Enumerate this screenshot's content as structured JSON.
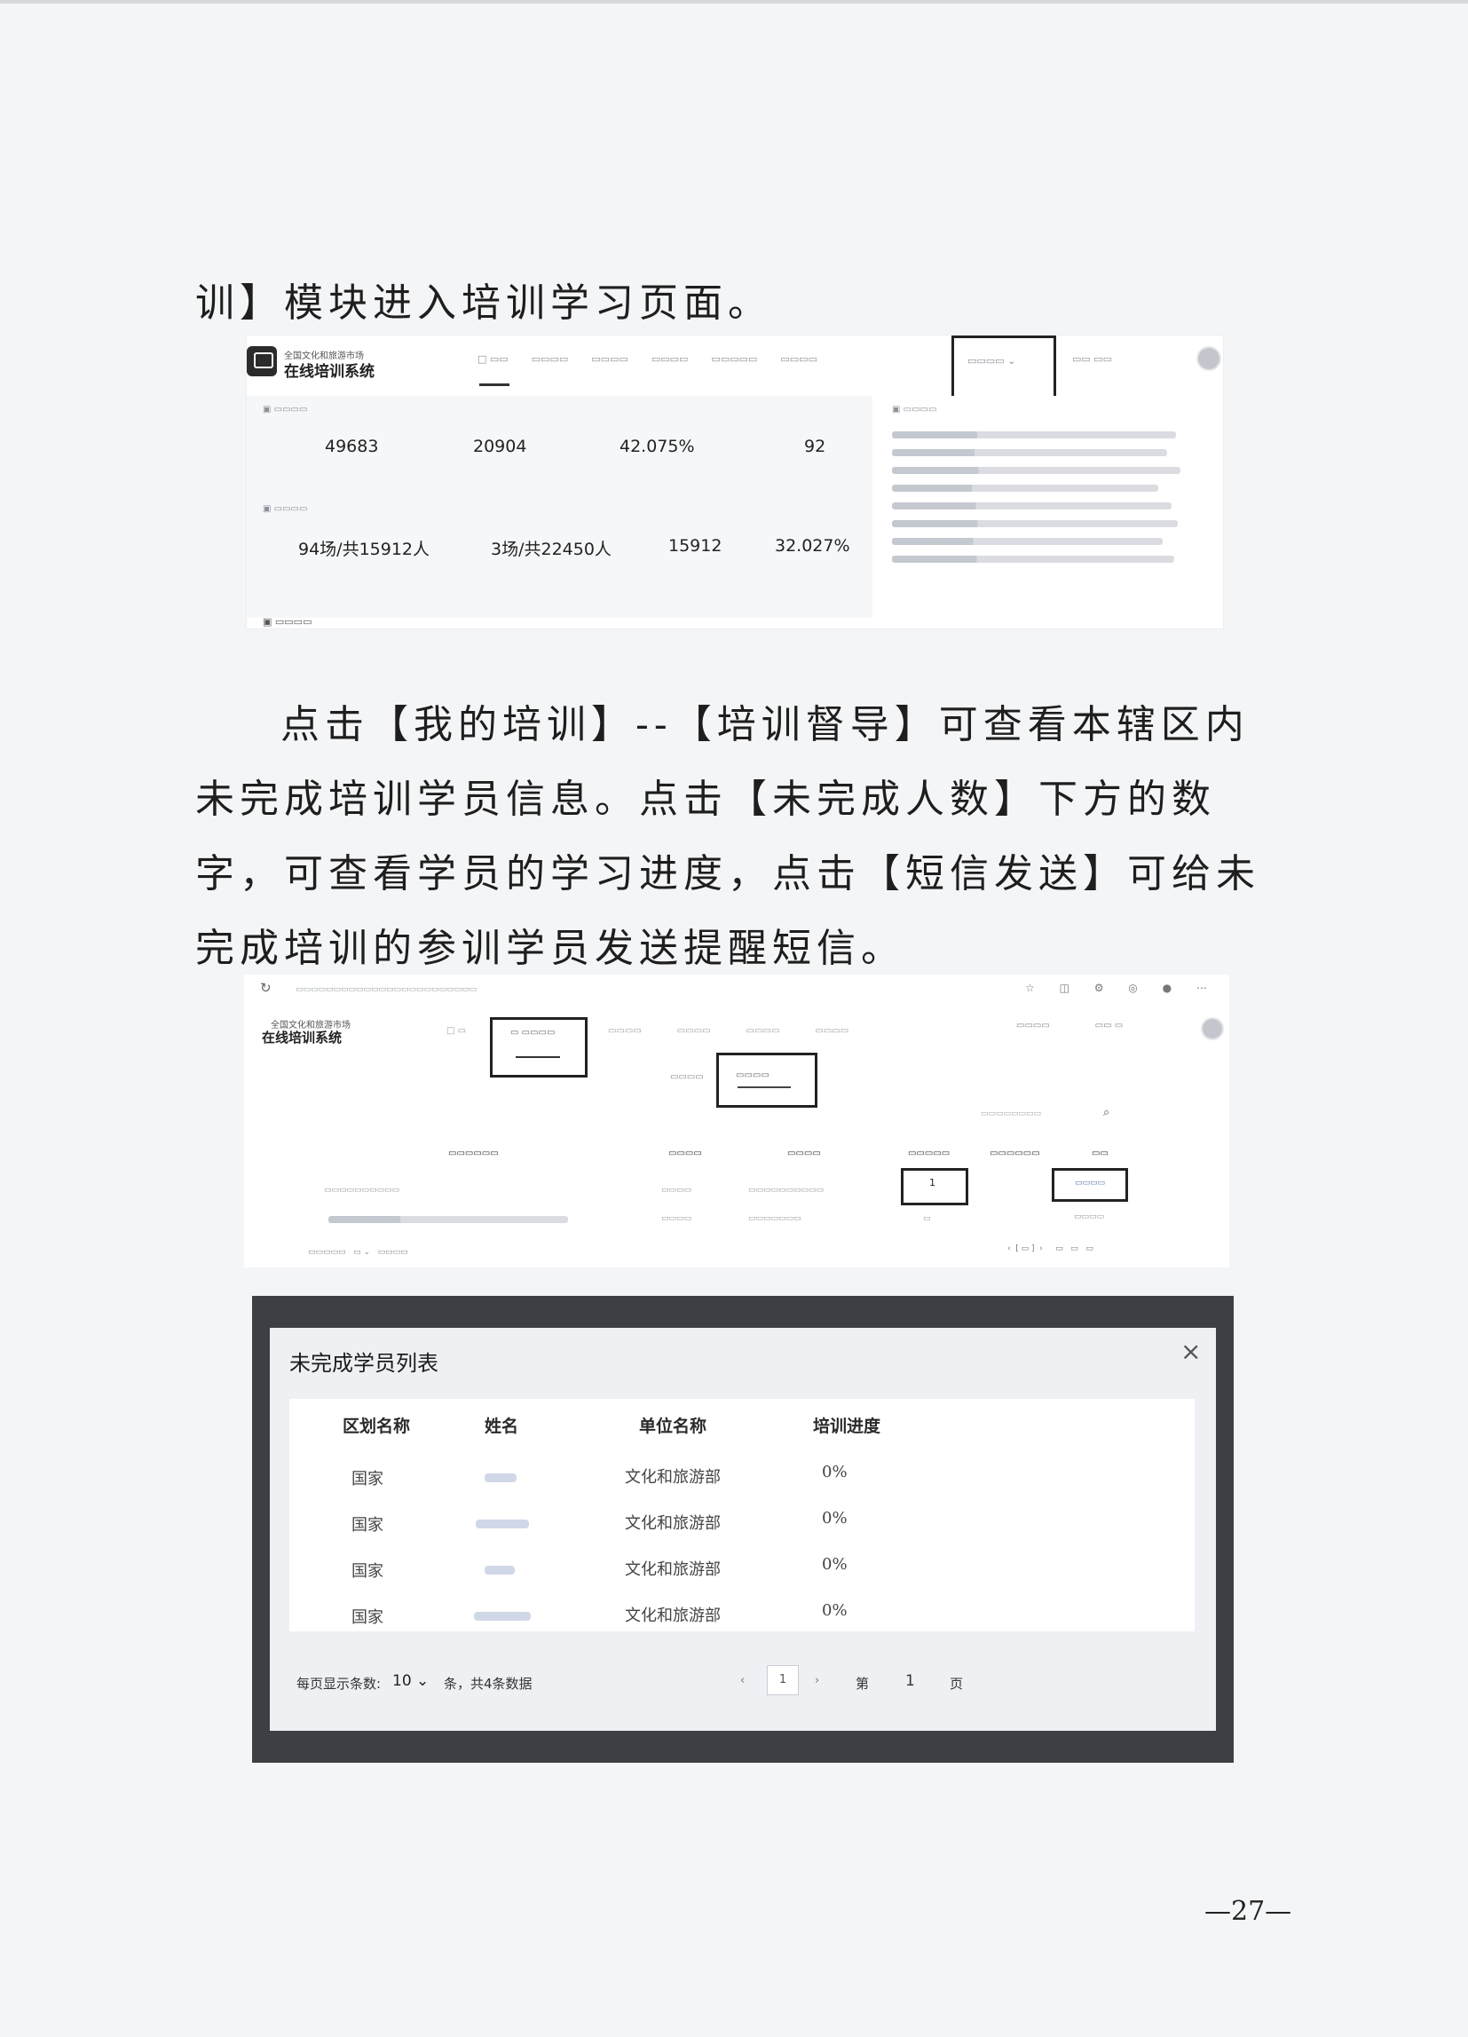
{
  "doc": {
    "intro_line": "训】模块进入培训学习页面。",
    "paragraph_main": "点击【我的培训】--【培训督导】可查看本辖区内未完成培训学员信息。点击【未完成人数】下方的数字，可查看学员的学习进度，点击【短信发送】可给未完成培训的参训学员发送提醒短信。",
    "page_number": "—27—"
  },
  "shot1": {
    "logo_main": "在线培训系统",
    "logo_sub": "全国文化和旅游市场",
    "stats_row1": [
      "49683",
      "20904",
      "42.075%",
      "92"
    ],
    "stats_row2": [
      "94场/共15912人",
      "3场/共22450人",
      "15912",
      "32.027%"
    ]
  },
  "shot2": {
    "logo_main": "在线培训系统",
    "logo_sub": "全国文化和旅游市场",
    "count_value": "1"
  },
  "modal": {
    "title": "未完成学员列表",
    "close_glyph": "×",
    "columns": [
      "区划名称",
      "姓名",
      "单位名称",
      "培训进度"
    ],
    "rows": [
      {
        "region": "国家",
        "unit": "文化和旅游部",
        "progress": "0%"
      },
      {
        "region": "国家",
        "unit": "文化和旅游部",
        "progress": "0%"
      },
      {
        "region": "国家",
        "unit": "文化和旅游部",
        "progress": "0%"
      },
      {
        "region": "国家",
        "unit": "文化和旅游部",
        "progress": "0%"
      }
    ],
    "footer": {
      "page_size_label": "每页显示条数:",
      "page_size_value": "10 ⌄",
      "total_text": "条，共4条数据",
      "prev": "‹",
      "page_input": "1",
      "next": "›",
      "page_prefix": "第",
      "page_current": "1",
      "page_suffix": "页"
    }
  }
}
